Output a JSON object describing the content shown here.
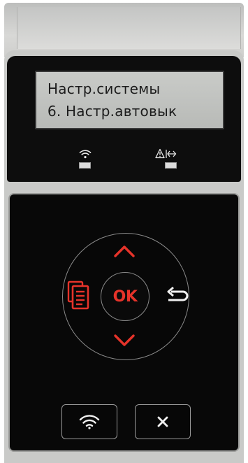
{
  "display": {
    "line1": "Настр.системы",
    "line2": "6. Настр.автовык"
  },
  "indicators": [
    {
      "name": "wifi-status",
      "icon": "wifi-icon"
    },
    {
      "name": "error-status",
      "icon": "warning-data-icon"
    }
  ],
  "dpad": {
    "center_label": "OK",
    "up_icon": "chevron-up-icon",
    "down_icon": "chevron-down-icon",
    "left_icon": "menu-icon",
    "right_icon": "back-icon"
  },
  "bottom_buttons": [
    {
      "icon": "wifi-icon"
    },
    {
      "icon": "close-icon"
    }
  ],
  "colors": {
    "accent": "#e6332a",
    "panel": "#0a0a0a",
    "lcd": "#c2c4c1",
    "bezel": "#c9cac8"
  }
}
